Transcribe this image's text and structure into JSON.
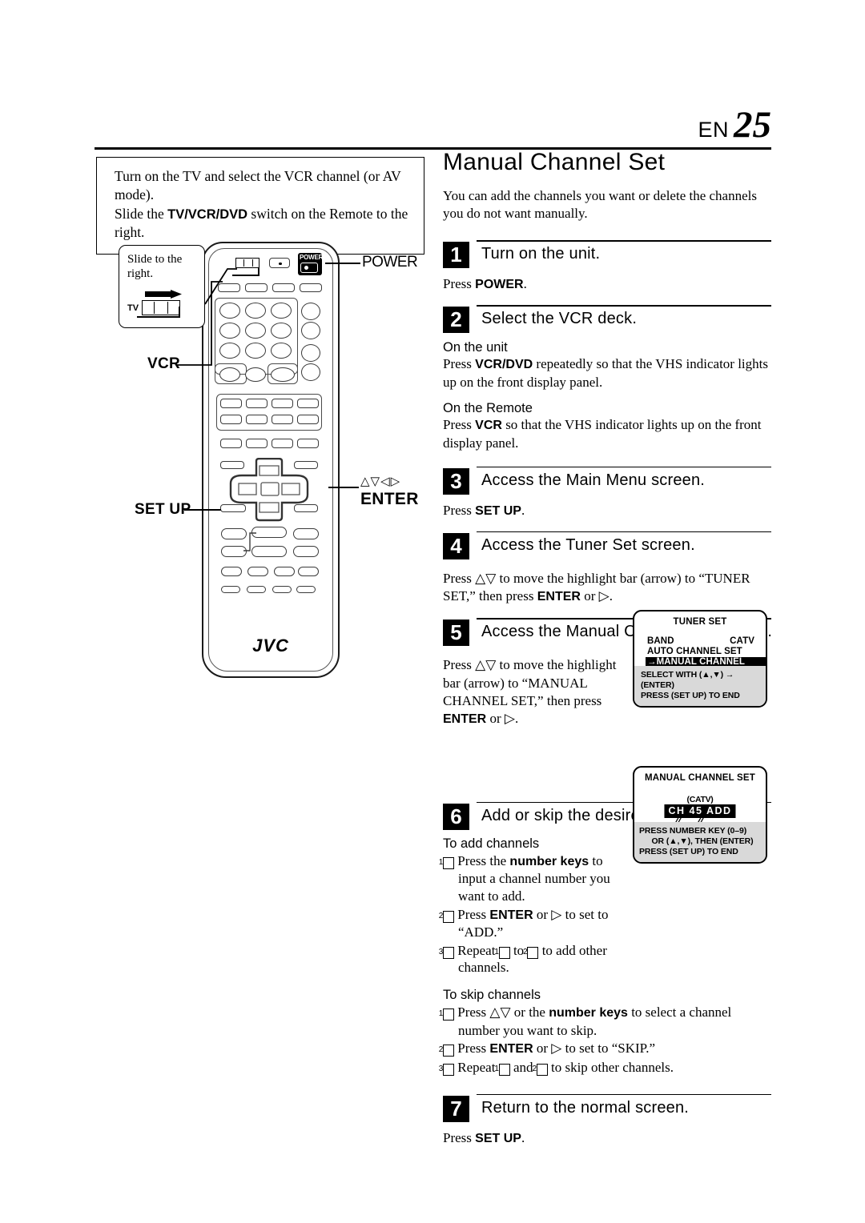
{
  "header": {
    "en_label": "EN",
    "page_number": "25"
  },
  "prep_box": {
    "line1": "Turn on the TV and select the VCR channel (or AV",
    "line1b": "mode).",
    "line2_pre": "Slide the ",
    "line2_bold": "TV/VCR/DVD",
    "line2_post": " switch on the Remote to the",
    "line2b": "right."
  },
  "remote": {
    "callout_text": "Slide to the right.",
    "callout_tv_label": "TV",
    "label_power": "POWER",
    "power_button_label": "POWER",
    "label_vcr": "VCR",
    "label_setup": "SET UP",
    "label_enter": "ENTER",
    "label_arrows": "△▽◁▷",
    "brand": "JVC"
  },
  "main": {
    "title": "Manual Channel Set",
    "intro": "You can add the channels you want or delete the channels you do not want manually.",
    "steps": [
      {
        "num": "1",
        "title": "Turn on the unit.",
        "press_pre": "Press ",
        "press_key": "POWER",
        "press_post": "."
      },
      {
        "num": "2",
        "title": "Select the VCR deck.",
        "sub1": "On the unit",
        "sub1_pre": "Press ",
        "sub1_key": "VCR/DVD",
        "sub1_post": " repeatedly so that the VHS indicator lights up on the front display panel.",
        "sub2": "On the Remote",
        "sub2_pre": "Press ",
        "sub2_key": "VCR",
        "sub2_post": " so that the VHS indicator lights up on the front display panel."
      },
      {
        "num": "3",
        "title": "Access the Main Menu screen.",
        "press_pre": "Press ",
        "press_key": "SET UP",
        "press_post": "."
      },
      {
        "num": "4",
        "title": "Access the Tuner Set screen.",
        "text_a": "Press △▽ to move the highlight bar (arrow) to “TUNER SET,” then press ",
        "text_key": "ENTER",
        "text_b": " or ▷."
      },
      {
        "num": "5",
        "title": "Access the Manual Channel Set screen.",
        "text_a": "Press △▽ to move the highlight bar (arrow) to “MANUAL CHANNEL SET,” then press ",
        "text_key": "ENTER",
        "text_b": " or ▷."
      },
      {
        "num": "6",
        "title": "Add or skip the desired channels.",
        "add_heading": "To add channels",
        "add_1a": "Press the ",
        "add_1b": "number keys",
        "add_1c": " to input a channel number you want to add.",
        "add_2a": "Press ",
        "add_2b": "ENTER",
        "add_2c": " or ▷ to set to “ADD.”",
        "add_3a": "Repeat ",
        "add_3b": " to ",
        "add_3c": " to add other channels.",
        "skip_heading": "To skip channels",
        "skip_1a": "Press △▽ or the ",
        "skip_1b": "number keys",
        "skip_1c": " to select a channel number you want to skip.",
        "skip_2a": "Press ",
        "skip_2b": "ENTER",
        "skip_2c": " or ▷ to set to “SKIP.”",
        "skip_3a": "Repeat ",
        "skip_3b": " and ",
        "skip_3c": " to skip other channels."
      },
      {
        "num": "7",
        "title": "Return to the normal screen.",
        "press_pre": "Press ",
        "press_key": "SET UP",
        "press_post": "."
      }
    ]
  },
  "osd_tuner_set": {
    "title": "TUNER SET",
    "band_label": "BAND",
    "band_value": "CATV",
    "auto_channel_set": "AUTO CHANNEL SET",
    "manual_channel_set": "→MANUAL CHANNEL SET",
    "footer_line1": "SELECT WITH (▲,▼) → (ENTER)",
    "footer_line2": "PRESS (SET UP) TO END"
  },
  "osd_manual_channel_set": {
    "title": "MANUAL CHANNEL SET",
    "band_caption": "(CATV)",
    "ch_label": "CH",
    "ch_number": "45",
    "ch_state": "ADD",
    "footer_line1": "PRESS NUMBER KEY (0–9)",
    "footer_line2": "OR (▲,▼), THEN (ENTER)",
    "footer_line3": "PRESS (SET UP) TO END"
  }
}
